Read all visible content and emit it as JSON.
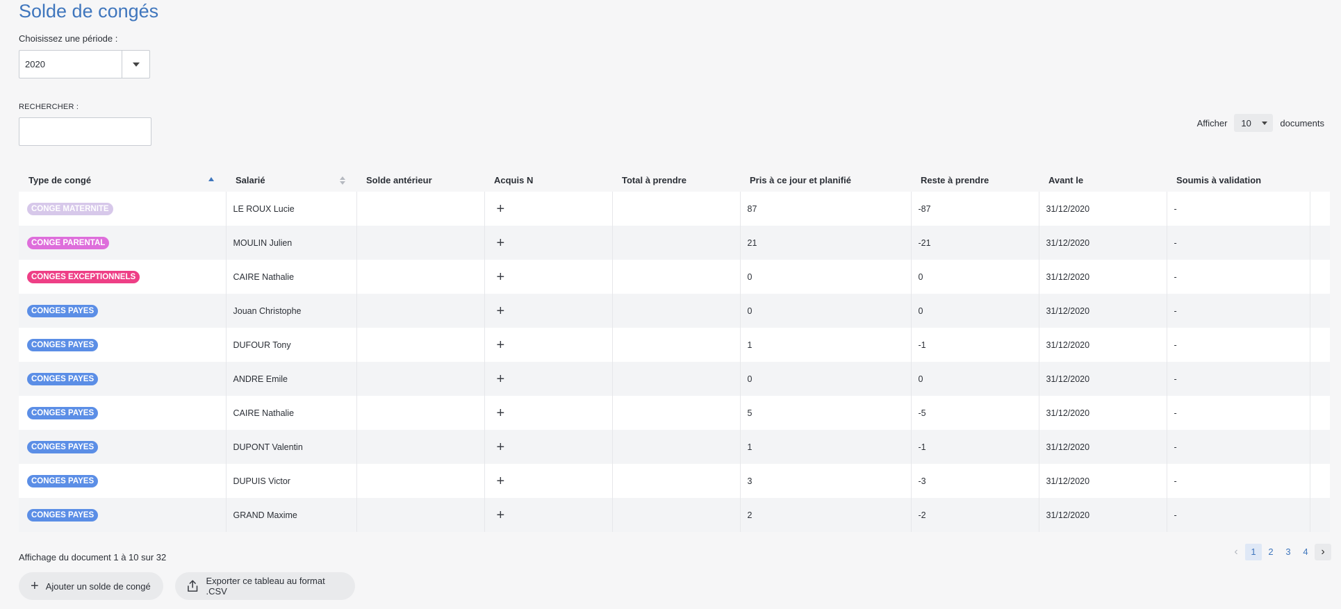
{
  "page": {
    "title": "Solde de congés"
  },
  "period": {
    "label": "Choisissez une période :",
    "value": "2020"
  },
  "search": {
    "label": "RECHERCHER :",
    "value": "",
    "placeholder": ""
  },
  "page_size": {
    "prefix": "Afficher",
    "value": "10",
    "suffix": "documents"
  },
  "table": {
    "columns": [
      "Type de congé",
      "Salarié",
      "Solde antérieur",
      "Acquis N",
      "Total à prendre",
      "Pris à ce jour et planifié",
      "Reste à prendre",
      "Avant le",
      "Soumis à validation"
    ],
    "sorted_column": "Type de congé",
    "sort_direction": "asc",
    "rows": [
      {
        "type": "CONGE MATERNITE",
        "type_color": "#d7c8ea",
        "employee": "LE ROUX Lucie",
        "previous": "",
        "acquired": "+",
        "total": "",
        "taken": "87",
        "remaining": "-87",
        "before": "31/12/2020",
        "validation": "-"
      },
      {
        "type": "CONGE PARENTAL",
        "type_color": "#de6edb",
        "employee": "MOULIN Julien",
        "previous": "",
        "acquired": "+",
        "total": "",
        "taken": "21",
        "remaining": "-21",
        "before": "31/12/2020",
        "validation": "-"
      },
      {
        "type": "CONGES EXCEPTIONNELS",
        "type_color": "#ee3f86",
        "employee": "CAIRE Nathalie",
        "previous": "",
        "acquired": "+",
        "total": "",
        "taken": "0",
        "remaining": "0",
        "before": "31/12/2020",
        "validation": "-"
      },
      {
        "type": "CONGES PAYES",
        "type_color": "#5b8ee6",
        "employee": "Jouan Christophe",
        "previous": "",
        "acquired": "+",
        "total": "",
        "taken": "0",
        "remaining": "0",
        "before": "31/12/2020",
        "validation": "-"
      },
      {
        "type": "CONGES PAYES",
        "type_color": "#5b8ee6",
        "employee": "DUFOUR Tony",
        "previous": "",
        "acquired": "+",
        "total": "",
        "taken": "1",
        "remaining": "-1",
        "before": "31/12/2020",
        "validation": "-"
      },
      {
        "type": "CONGES PAYES",
        "type_color": "#5b8ee6",
        "employee": "ANDRE Emile",
        "previous": "",
        "acquired": "+",
        "total": "",
        "taken": "0",
        "remaining": "0",
        "before": "31/12/2020",
        "validation": "-"
      },
      {
        "type": "CONGES PAYES",
        "type_color": "#5b8ee6",
        "employee": "CAIRE Nathalie",
        "previous": "",
        "acquired": "+",
        "total": "",
        "taken": "5",
        "remaining": "-5",
        "before": "31/12/2020",
        "validation": "-"
      },
      {
        "type": "CONGES PAYES",
        "type_color": "#5b8ee6",
        "employee": "DUPONT Valentin",
        "previous": "",
        "acquired": "+",
        "total": "",
        "taken": "1",
        "remaining": "-1",
        "before": "31/12/2020",
        "validation": "-"
      },
      {
        "type": "CONGES PAYES",
        "type_color": "#5b8ee6",
        "employee": "DUPUIS Victor",
        "previous": "",
        "acquired": "+",
        "total": "",
        "taken": "3",
        "remaining": "-3",
        "before": "31/12/2020",
        "validation": "-"
      },
      {
        "type": "CONGES PAYES",
        "type_color": "#5b8ee6",
        "employee": "GRAND Maxime",
        "previous": "",
        "acquired": "+",
        "total": "",
        "taken": "2",
        "remaining": "-2",
        "before": "31/12/2020",
        "validation": "-"
      }
    ]
  },
  "summary": "Affichage du document 1 à 10 sur 32",
  "pagination": {
    "prev": "‹",
    "pages": [
      "1",
      "2",
      "3",
      "4"
    ],
    "current": "1",
    "next": "›"
  },
  "actions": {
    "add_label": "Ajouter un solde de congé",
    "add_icon": "plus-icon",
    "export_label": "Exporter ce tableau au format .CSV",
    "export_icon": "upload-icon"
  },
  "colors": {
    "accent": "#3f76bd",
    "background": "#f6f6f7"
  }
}
